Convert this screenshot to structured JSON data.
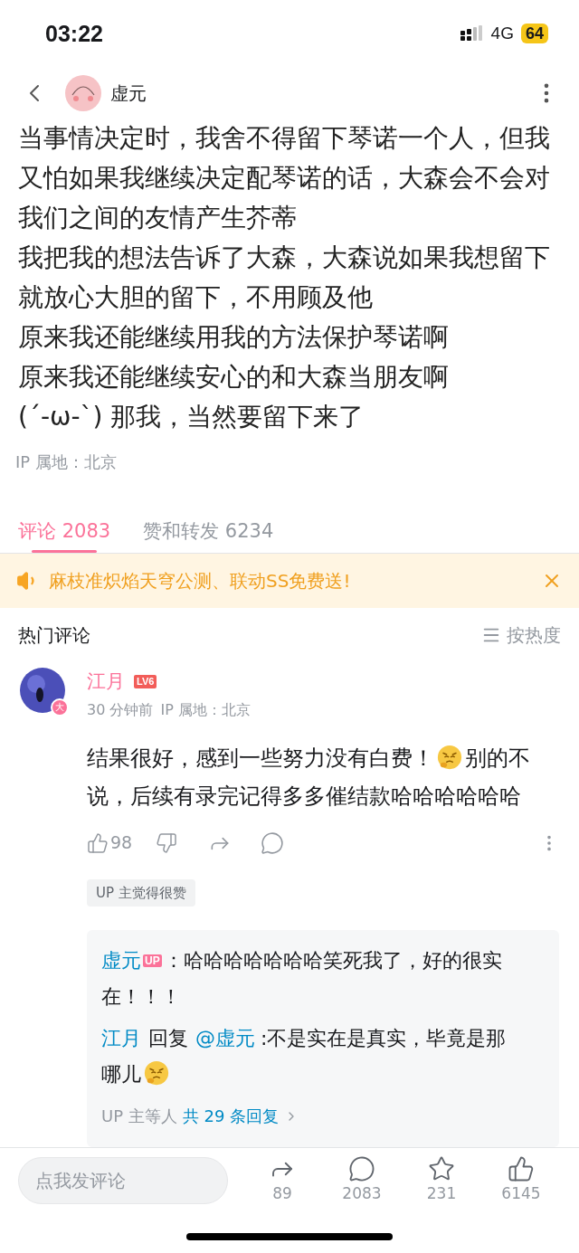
{
  "status_bar": {
    "time": "03:22",
    "network": "4G",
    "battery": "64"
  },
  "header": {
    "author": "虚元"
  },
  "post": {
    "paragraphs": [
      "当事情决定时，我舍不得留下琴诺一个人，但我又怕如果我继续决定配琴诺的话，大森会不会对我们之间的友情产生芥蒂",
      "我把我的想法告诉了大森，大森说如果我想留下就放心大胆的留下，不用顾及他",
      "原来我还能继续用我的方法保护琴诺啊",
      "原来我还能继续安心的和大森当朋友啊",
      "(´-ω-`) 那我，当然要留下来了"
    ],
    "ip": "IP 属地：北京"
  },
  "tabs": [
    {
      "label": "评论 2083",
      "selected": true
    },
    {
      "label": "赞和转发 6234",
      "selected": false
    }
  ],
  "banner": {
    "text": "麻枝准炽焰天穹公测、联动SS免费送!"
  },
  "comments_header": {
    "title": "热门评论",
    "sort": "按热度"
  },
  "comment": {
    "user": "江月",
    "level": "LV6",
    "avatar_badge": "大",
    "time": "30 分钟前",
    "ip": "IP 属地：北京",
    "body": [
      {
        "kind": "text",
        "text": "结果很好，感到一些努力没有白费！"
      },
      {
        "kind": "emoji"
      },
      {
        "kind": "text",
        "text": "别的不"
      },
      {
        "kind": "text",
        "text": "说，后续有录完记得多多催结款哈哈哈哈哈哈"
      }
    ],
    "likes": "98",
    "tag": "UP 主觉得很赞",
    "replies": [
      {
        "user": "虚元",
        "badge": "UP",
        "body": [
          {
            "kind": "text",
            "text": "：哈哈哈哈哈哈哈笑死我了，好的很实"
          },
          {
            "kind": "text",
            "text": "在！！！"
          }
        ]
      },
      {
        "user": "江月",
        "reply_word": "回复",
        "target": "@虚元",
        "body": [
          {
            "kind": "text",
            "text": ":不是实在是真实，毕竟是那"
          },
          {
            "kind": "text",
            "text": "哪儿"
          },
          {
            "kind": "emoji"
          }
        ]
      }
    ],
    "more": {
      "prefix": "UP 主等人",
      "link": "共 29 条回复"
    }
  },
  "bottom_bar": {
    "placeholder": "点我发评论",
    "share": "89",
    "comments": "2083",
    "favorites": "231",
    "likes": "6145"
  }
}
